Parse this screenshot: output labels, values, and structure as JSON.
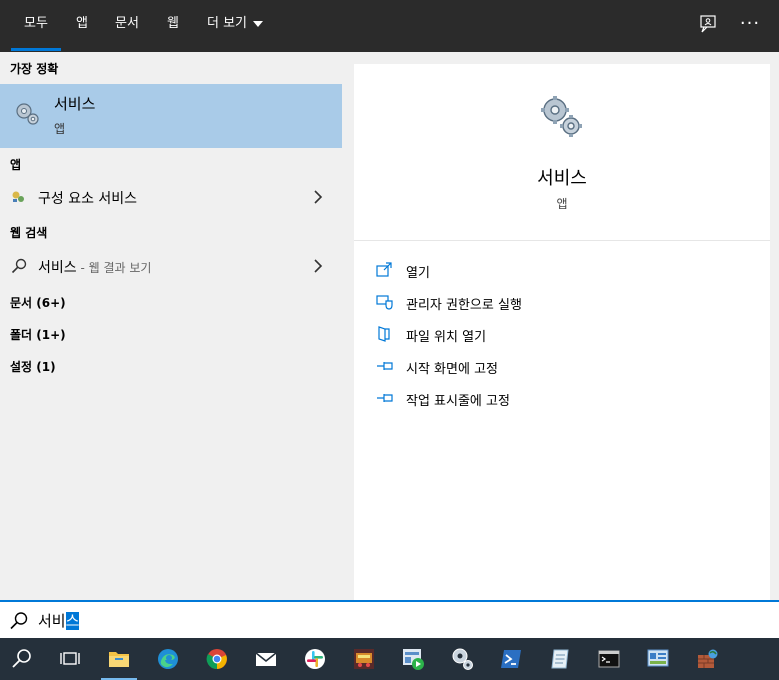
{
  "tabs": [
    {
      "label": "모두",
      "active": true
    },
    {
      "label": "앱"
    },
    {
      "label": "문서"
    },
    {
      "label": "웹"
    },
    {
      "label": "더 보기"
    }
  ],
  "topbar_icons": [
    "feedback-icon",
    "more-options-icon"
  ],
  "more_icon_text": "···",
  "best_match": {
    "header": "가장 정확",
    "title": "서비스",
    "subtitle": "앱",
    "icon": "services-gears-icon"
  },
  "apps": {
    "header": "앱",
    "items": [
      {
        "label": "구성 요소 서비스",
        "icon": "component-services-icon"
      }
    ]
  },
  "web": {
    "header": "웹 검색",
    "items": [
      {
        "label": "서비스",
        "suffix": " - 웹 결과 보기",
        "icon": "search-icon"
      }
    ]
  },
  "categories": [
    {
      "label": "문서 (6+)"
    },
    {
      "label": "폴더 (1+)"
    },
    {
      "label": "설정 (1)"
    }
  ],
  "preview": {
    "title": "서비스",
    "subtitle": "앱",
    "icon": "services-gears-icon",
    "actions": [
      {
        "label": "열기",
        "icon": "open-icon"
      },
      {
        "label": "관리자 권한으로 실행",
        "icon": "run-as-admin-icon"
      },
      {
        "label": "파일 위치 열기",
        "icon": "file-location-icon"
      },
      {
        "label": "시작 화면에 고정",
        "icon": "pin-icon"
      },
      {
        "label": "작업 표시줄에 고정",
        "icon": "pin-icon"
      }
    ]
  },
  "search": {
    "value_prefix": "서비",
    "value_selected": "스"
  },
  "taskbar": {
    "items": [
      "search-icon",
      "task-view-icon",
      "file-explorer-icon",
      "edge-icon",
      "chrome-icon",
      "mail-icon",
      "slack-icon",
      "game-app-icon",
      "media-app-icon",
      "services-icon",
      "powershell-icon",
      "notepad-icon",
      "command-prompt-icon",
      "control-panel-icon",
      "app-icon"
    ]
  },
  "colors": {
    "accent": "#0078d7",
    "selected": "#a9cbe8",
    "topbar": "#2b2b2b",
    "taskbar": "#25303b"
  }
}
